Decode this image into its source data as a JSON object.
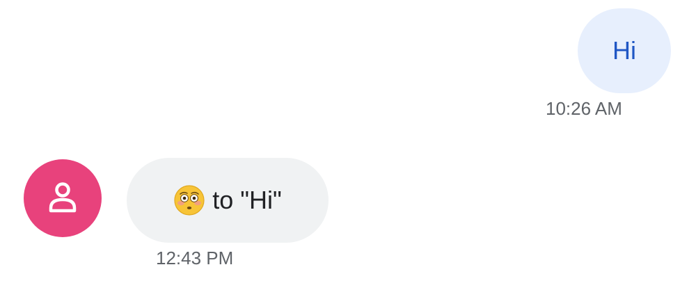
{
  "conversation": {
    "messages": [
      {
        "direction": "sent",
        "text": "Hi",
        "timestamp": "10:26 AM"
      },
      {
        "direction": "received",
        "emoji": "flushed-face-emoji",
        "text": "to \"Hi\"",
        "timestamp": "12:43 PM"
      }
    ]
  },
  "icons": {
    "avatar": "person-icon",
    "reaction": "flushed-face-emoji"
  },
  "colors": {
    "sent_bubble": "#e7effd",
    "sent_text": "#1f56c4",
    "received_bubble": "#f0f2f3",
    "received_text": "#202124",
    "timestamp": "#5f6368",
    "avatar_bg": "#e8427c"
  }
}
